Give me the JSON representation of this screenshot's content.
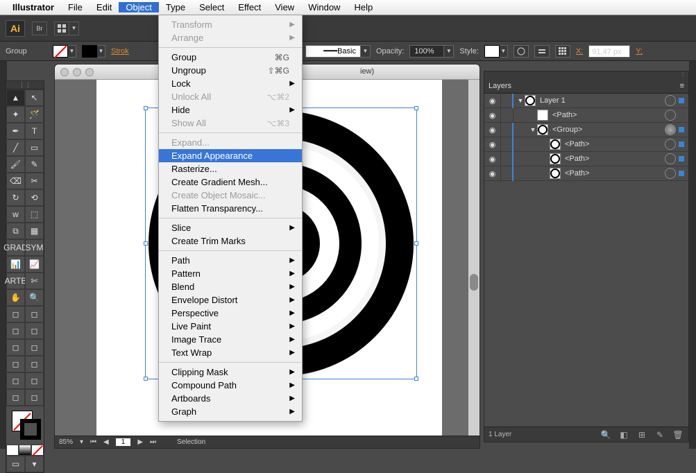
{
  "menubar": {
    "app": "Illustrator",
    "items": [
      "File",
      "Edit",
      "Object",
      "Type",
      "Select",
      "Effect",
      "View",
      "Window",
      "Help"
    ],
    "active": "Object"
  },
  "dropdown": {
    "groups": [
      [
        {
          "label": "Transform",
          "submenu": true,
          "disabled": true
        },
        {
          "label": "Arrange",
          "submenu": true,
          "disabled": true
        }
      ],
      [
        {
          "label": "Group",
          "shortcut": "⌘G"
        },
        {
          "label": "Ungroup",
          "shortcut": "⇧⌘G"
        },
        {
          "label": "Lock",
          "submenu": true
        },
        {
          "label": "Unlock All",
          "shortcut": "⌥⌘2",
          "disabled": true
        },
        {
          "label": "Hide",
          "submenu": true
        },
        {
          "label": "Show All",
          "shortcut": "⌥⌘3",
          "disabled": true
        }
      ],
      [
        {
          "label": "Expand...",
          "disabled": true
        },
        {
          "label": "Expand Appearance",
          "highlight": true
        },
        {
          "label": "Rasterize..."
        },
        {
          "label": "Create Gradient Mesh..."
        },
        {
          "label": "Create Object Mosaic...",
          "disabled": true
        },
        {
          "label": "Flatten Transparency..."
        }
      ],
      [
        {
          "label": "Slice",
          "submenu": true
        },
        {
          "label": "Create Trim Marks"
        }
      ],
      [
        {
          "label": "Path",
          "submenu": true
        },
        {
          "label": "Pattern",
          "submenu": true
        },
        {
          "label": "Blend",
          "submenu": true
        },
        {
          "label": "Envelope Distort",
          "submenu": true
        },
        {
          "label": "Perspective",
          "submenu": true
        },
        {
          "label": "Live Paint",
          "submenu": true
        },
        {
          "label": "Image Trace",
          "submenu": true
        },
        {
          "label": "Text Wrap",
          "submenu": true
        }
      ],
      [
        {
          "label": "Clipping Mask",
          "submenu": true
        },
        {
          "label": "Compound Path",
          "submenu": true
        },
        {
          "label": "Artboards",
          "submenu": true
        },
        {
          "label": "Graph",
          "submenu": true
        }
      ]
    ]
  },
  "app_top": {
    "logo": "Ai",
    "br_label": "Br"
  },
  "options_bar": {
    "selection_label": "Group",
    "stroke_label": "Strok",
    "brush_value": "Basic",
    "opacity_label": "Opacity:",
    "opacity_value": "100%",
    "style_label": "Style:",
    "x_label": "X:",
    "x_value": "91,47 px",
    "y_label": "Y:"
  },
  "doc": {
    "title_suffix": "iew)",
    "zoom": "85%",
    "artboard_nav": "1",
    "status": "Selection"
  },
  "layers": {
    "tab": "Layers",
    "rows": [
      {
        "indent": 0,
        "twisty": "▼",
        "name": "Layer 1",
        "thumb": "rings",
        "target": false,
        "selected": true
      },
      {
        "indent": 1,
        "twisty": "",
        "name": "<Path>",
        "thumb": "blank",
        "target": false,
        "selected": false
      },
      {
        "indent": 1,
        "twisty": "▼",
        "name": "<Group>",
        "thumb": "rings",
        "target": true,
        "selected": true
      },
      {
        "indent": 2,
        "twisty": "",
        "name": "<Path>",
        "thumb": "rings",
        "target": false,
        "selected": true
      },
      {
        "indent": 2,
        "twisty": "",
        "name": "<Path>",
        "thumb": "rings",
        "target": false,
        "selected": true
      },
      {
        "indent": 2,
        "twisty": "",
        "name": "<Path>",
        "thumb": "rings",
        "target": false,
        "selected": true
      }
    ],
    "footer": "1 Layer"
  },
  "icons": {
    "eye": "◉",
    "chevron": "▾",
    "menu": "≡"
  }
}
